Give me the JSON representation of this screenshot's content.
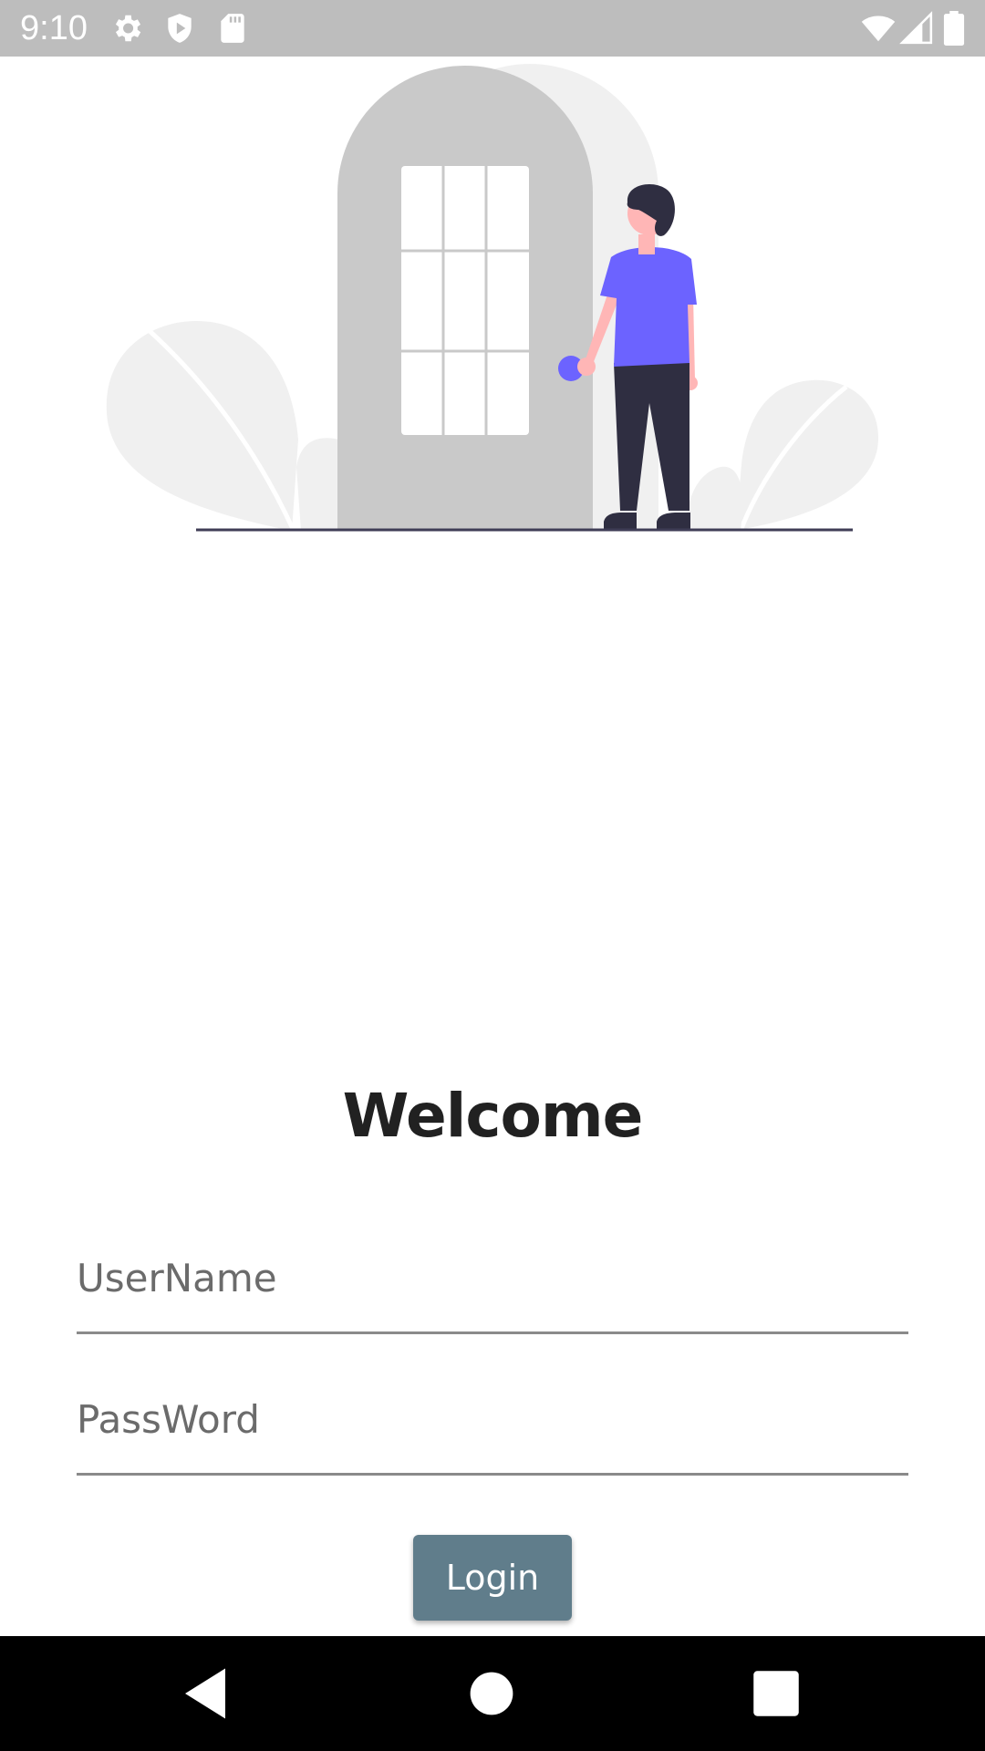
{
  "status_bar": {
    "time": "9:10",
    "icons": [
      "gear-icon",
      "shield-icon",
      "sd-card-icon",
      "wifi-icon",
      "cell-signal-icon",
      "battery-icon"
    ]
  },
  "illustration": {
    "name": "person-at-door-illustration",
    "colors": {
      "accent": "#6c63ff",
      "door": "#c9c9c9",
      "leaves": "#f0f0f0",
      "skin": "#ffb6b6",
      "dark": "#2f2e41"
    }
  },
  "welcome": {
    "title": "Welcome"
  },
  "form": {
    "username_placeholder": "UserName",
    "username_value": "",
    "password_placeholder": "PassWord",
    "password_value": "",
    "login_label": "Login"
  },
  "nav_bar": {
    "buttons": [
      "back-icon",
      "home-icon",
      "recents-icon"
    ]
  },
  "colors": {
    "status_bar": "#bdbdbd",
    "button": "#607d8b",
    "nav_bar": "#000000"
  }
}
